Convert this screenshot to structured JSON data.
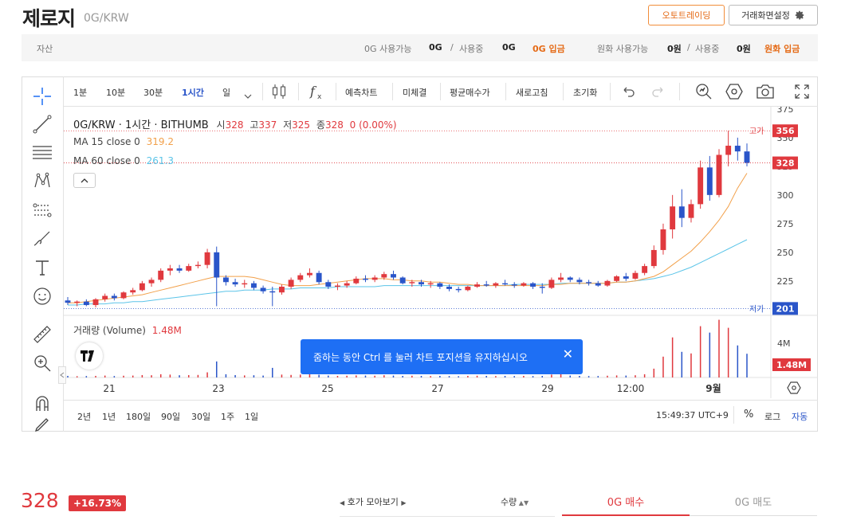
{
  "header": {
    "title": "제로지",
    "pair": "0G/KRW",
    "auto_trading": "오토트레이딩",
    "screen_settings": "거래화면설정"
  },
  "asset_bar": {
    "label": "자산",
    "coin_available_label": "0G 사용가능",
    "coin_available": "0G",
    "coin_in_use_label": "사용중",
    "coin_in_use": "0G",
    "coin_deposit": "0G 입금",
    "krw_available_label": "원화 사용가능",
    "krw_available": "0원",
    "krw_in_use_label": "사용중",
    "krw_in_use": "0원",
    "krw_deposit": "원화 입금"
  },
  "toolbar": {
    "intervals": [
      "1분",
      "10분",
      "30분",
      "1시간",
      "일"
    ],
    "active_interval": "1시간",
    "buttons": [
      "예측차트",
      "미체결",
      "평균매수가",
      "새로고침",
      "초기화"
    ]
  },
  "chart_data": {
    "type": "candlestick",
    "title": "0G/KRW · 1시간 · BITHUMB",
    "ohlc_labels": {
      "open": "시",
      "high": "고",
      "low": "저",
      "volume": "종"
    },
    "ohlc": {
      "open": "328",
      "high": "337",
      "low": "325",
      "close": "328",
      "change": "0 (0.00%)"
    },
    "ma15": {
      "label": "MA 15 close 0",
      "value": "319.2",
      "color": "#f2a04a"
    },
    "ma60": {
      "label": "MA 60 close 0",
      "value": "261.3",
      "color": "#5bc4e8"
    },
    "volume_label": "거래량 (Volume)",
    "volume_value": "1.48M",
    "volume_axis": "4M",
    "price_ticks": [
      375,
      350,
      325,
      300,
      275,
      250,
      225
    ],
    "ylim": [
      195,
      377
    ],
    "high_label": "고가",
    "high_value": 356,
    "low_label": "저가",
    "low_value": 201,
    "last_price": 328,
    "x_ticks": [
      "21",
      "23",
      "25",
      "27",
      "29",
      "12:00",
      "9월"
    ],
    "up_color": "#e0393e",
    "down_color": "#2a55c9",
    "series": [
      {
        "t": 0,
        "o": 208,
        "h": 211,
        "l": 204,
        "c": 206
      },
      {
        "t": 1,
        "o": 206,
        "h": 208,
        "l": 203,
        "c": 207
      },
      {
        "t": 2,
        "o": 207,
        "h": 209,
        "l": 203,
        "c": 204
      },
      {
        "t": 3,
        "o": 204,
        "h": 210,
        "l": 202,
        "c": 209
      },
      {
        "t": 4,
        "o": 209,
        "h": 214,
        "l": 207,
        "c": 212
      },
      {
        "t": 5,
        "o": 212,
        "h": 214,
        "l": 208,
        "c": 210
      },
      {
        "t": 6,
        "o": 210,
        "h": 216,
        "l": 209,
        "c": 215
      },
      {
        "t": 7,
        "o": 215,
        "h": 219,
        "l": 213,
        "c": 217
      },
      {
        "t": 8,
        "o": 217,
        "h": 225,
        "l": 216,
        "c": 223
      },
      {
        "t": 9,
        "o": 223,
        "h": 228,
        "l": 220,
        "c": 226
      },
      {
        "t": 10,
        "o": 226,
        "h": 236,
        "l": 224,
        "c": 234
      },
      {
        "t": 11,
        "o": 234,
        "h": 239,
        "l": 230,
        "c": 236
      },
      {
        "t": 12,
        "o": 236,
        "h": 239,
        "l": 232,
        "c": 234
      },
      {
        "t": 13,
        "o": 234,
        "h": 240,
        "l": 233,
        "c": 238
      },
      {
        "t": 14,
        "o": 238,
        "h": 242,
        "l": 236,
        "c": 239
      },
      {
        "t": 15,
        "o": 239,
        "h": 253,
        "l": 236,
        "c": 250
      },
      {
        "t": 16,
        "o": 250,
        "h": 255,
        "l": 203,
        "c": 228
      },
      {
        "t": 17,
        "o": 228,
        "h": 230,
        "l": 221,
        "c": 224
      },
      {
        "t": 18,
        "o": 224,
        "h": 227,
        "l": 220,
        "c": 222
      },
      {
        "t": 19,
        "o": 222,
        "h": 226,
        "l": 219,
        "c": 223
      },
      {
        "t": 20,
        "o": 223,
        "h": 225,
        "l": 217,
        "c": 219
      },
      {
        "t": 21,
        "o": 219,
        "h": 221,
        "l": 214,
        "c": 216
      },
      {
        "t": 22,
        "o": 216,
        "h": 220,
        "l": 203,
        "c": 215
      },
      {
        "t": 23,
        "o": 215,
        "h": 222,
        "l": 213,
        "c": 220
      },
      {
        "t": 24,
        "o": 220,
        "h": 228,
        "l": 218,
        "c": 226
      },
      {
        "t": 25,
        "o": 226,
        "h": 232,
        "l": 224,
        "c": 230
      },
      {
        "t": 26,
        "o": 230,
        "h": 236,
        "l": 228,
        "c": 232
      },
      {
        "t": 27,
        "o": 232,
        "h": 234,
        "l": 222,
        "c": 224
      },
      {
        "t": 28,
        "o": 224,
        "h": 226,
        "l": 218,
        "c": 220
      },
      {
        "t": 29,
        "o": 220,
        "h": 223,
        "l": 217,
        "c": 221
      },
      {
        "t": 30,
        "o": 221,
        "h": 225,
        "l": 219,
        "c": 223
      },
      {
        "t": 31,
        "o": 223,
        "h": 229,
        "l": 222,
        "c": 227
      },
      {
        "t": 32,
        "o": 227,
        "h": 230,
        "l": 224,
        "c": 226
      },
      {
        "t": 33,
        "o": 226,
        "h": 230,
        "l": 224,
        "c": 228
      },
      {
        "t": 34,
        "o": 228,
        "h": 233,
        "l": 226,
        "c": 231
      },
      {
        "t": 35,
        "o": 231,
        "h": 234,
        "l": 226,
        "c": 228
      },
      {
        "t": 36,
        "o": 228,
        "h": 229,
        "l": 222,
        "c": 223
      },
      {
        "t": 37,
        "o": 223,
        "h": 226,
        "l": 220,
        "c": 224
      },
      {
        "t": 38,
        "o": 224,
        "h": 226,
        "l": 220,
        "c": 222
      },
      {
        "t": 39,
        "o": 222,
        "h": 225,
        "l": 219,
        "c": 223
      },
      {
        "t": 40,
        "o": 223,
        "h": 224,
        "l": 218,
        "c": 220
      },
      {
        "t": 41,
        "o": 220,
        "h": 222,
        "l": 216,
        "c": 218
      },
      {
        "t": 42,
        "o": 218,
        "h": 220,
        "l": 215,
        "c": 217
      },
      {
        "t": 43,
        "o": 217,
        "h": 221,
        "l": 216,
        "c": 220
      },
      {
        "t": 44,
        "o": 220,
        "h": 224,
        "l": 219,
        "c": 222
      },
      {
        "t": 45,
        "o": 222,
        "h": 225,
        "l": 220,
        "c": 221
      },
      {
        "t": 46,
        "o": 221,
        "h": 224,
        "l": 219,
        "c": 223
      },
      {
        "t": 47,
        "o": 223,
        "h": 226,
        "l": 221,
        "c": 222
      },
      {
        "t": 48,
        "o": 222,
        "h": 224,
        "l": 219,
        "c": 221
      },
      {
        "t": 49,
        "o": 221,
        "h": 224,
        "l": 220,
        "c": 223
      },
      {
        "t": 50,
        "o": 223,
        "h": 224,
        "l": 218,
        "c": 220
      },
      {
        "t": 51,
        "o": 220,
        "h": 223,
        "l": 214,
        "c": 219
      },
      {
        "t": 52,
        "o": 219,
        "h": 228,
        "l": 218,
        "c": 226
      },
      {
        "t": 53,
        "o": 226,
        "h": 232,
        "l": 224,
        "c": 228
      },
      {
        "t": 54,
        "o": 228,
        "h": 229,
        "l": 224,
        "c": 226
      },
      {
        "t": 55,
        "o": 226,
        "h": 228,
        "l": 222,
        "c": 224
      },
      {
        "t": 56,
        "o": 224,
        "h": 226,
        "l": 221,
        "c": 223
      },
      {
        "t": 57,
        "o": 223,
        "h": 225,
        "l": 220,
        "c": 221
      },
      {
        "t": 58,
        "o": 221,
        "h": 226,
        "l": 220,
        "c": 225
      },
      {
        "t": 59,
        "o": 225,
        "h": 230,
        "l": 224,
        "c": 229
      },
      {
        "t": 60,
        "o": 229,
        "h": 232,
        "l": 225,
        "c": 227
      },
      {
        "t": 61,
        "o": 227,
        "h": 234,
        "l": 226,
        "c": 232
      },
      {
        "t": 62,
        "o": 232,
        "h": 240,
        "l": 230,
        "c": 238
      },
      {
        "t": 63,
        "o": 238,
        "h": 256,
        "l": 236,
        "c": 252
      },
      {
        "t": 64,
        "o": 252,
        "h": 275,
        "l": 248,
        "c": 270
      },
      {
        "t": 65,
        "o": 270,
        "h": 300,
        "l": 262,
        "c": 290
      },
      {
        "t": 66,
        "o": 290,
        "h": 305,
        "l": 272,
        "c": 280
      },
      {
        "t": 67,
        "o": 280,
        "h": 296,
        "l": 276,
        "c": 292
      },
      {
        "t": 68,
        "o": 292,
        "h": 330,
        "l": 288,
        "c": 324
      },
      {
        "t": 69,
        "o": 324,
        "h": 334,
        "l": 295,
        "c": 300
      },
      {
        "t": 70,
        "o": 300,
        "h": 340,
        "l": 298,
        "c": 335
      },
      {
        "t": 71,
        "o": 335,
        "h": 356,
        "l": 325,
        "c": 343
      },
      {
        "t": 72,
        "o": 343,
        "h": 350,
        "l": 330,
        "c": 338
      },
      {
        "t": 73,
        "o": 338,
        "h": 345,
        "l": 325,
        "c": 328
      }
    ],
    "volume_series": [
      0.1,
      0.08,
      0.09,
      0.1,
      0.12,
      0.09,
      0.11,
      0.12,
      0.15,
      0.14,
      0.2,
      0.18,
      0.14,
      0.15,
      0.16,
      0.32,
      1.0,
      0.2,
      0.15,
      0.13,
      0.14,
      0.12,
      0.6,
      0.18,
      0.16,
      0.18,
      0.22,
      0.17,
      0.12,
      0.1,
      0.11,
      0.13,
      0.12,
      0.11,
      0.14,
      0.12,
      0.1,
      0.11,
      0.1,
      0.09,
      0.1,
      0.09,
      0.08,
      0.1,
      0.11,
      0.1,
      0.09,
      0.1,
      0.09,
      0.1,
      0.09,
      0.1,
      0.18,
      0.2,
      0.12,
      0.1,
      0.09,
      0.09,
      0.11,
      0.13,
      0.12,
      0.14,
      0.2,
      0.55,
      1.3,
      2.5,
      1.6,
      1.5,
      3.2,
      2.8,
      3.6,
      3.1,
      2.0,
      1.48
    ],
    "ma15_values": [
      206,
      206,
      207,
      208,
      209,
      210,
      211,
      212,
      213,
      215,
      217,
      219,
      221,
      223,
      225,
      227,
      229,
      229,
      229,
      229,
      228,
      226,
      224,
      222,
      221,
      221,
      221,
      222,
      223,
      224,
      225,
      226,
      227,
      227,
      227,
      226,
      226,
      225,
      225,
      224,
      224,
      223,
      222,
      222,
      221,
      221,
      221,
      221,
      221,
      221,
      221,
      221,
      222,
      222,
      223,
      223,
      223,
      223,
      223,
      224,
      224,
      225,
      227,
      229,
      233,
      239,
      245,
      251,
      259,
      268,
      278,
      290,
      306,
      319
    ],
    "ma60_values": [
      204,
      204,
      205,
      205,
      205,
      206,
      206,
      207,
      207,
      208,
      209,
      210,
      211,
      212,
      213,
      214,
      215,
      216,
      216,
      217,
      217,
      217,
      218,
      218,
      218,
      219,
      219,
      219,
      219,
      220,
      220,
      220,
      220,
      220,
      221,
      221,
      221,
      221,
      221,
      221,
      221,
      221,
      221,
      221,
      221,
      221,
      221,
      221,
      222,
      222,
      222,
      222,
      222,
      223,
      223,
      223,
      223,
      223,
      223,
      224,
      224,
      225,
      226,
      227,
      229,
      231,
      234,
      237,
      241,
      245,
      249,
      253,
      257,
      261
    ]
  },
  "timebar": {
    "ranges": [
      "2년",
      "1년",
      "180일",
      "90일",
      "30일",
      "1주",
      "1일"
    ],
    "clock": "15:49:37 UTC+9",
    "percent": "%",
    "log": "로그",
    "auto": "자동"
  },
  "toast": {
    "message": "줌하는 동안 Ctrl 를 눌러 차트 포지션을 유지하십시오"
  },
  "bottom": {
    "price": "328",
    "change": "+16.73%",
    "hoga_view": "호가 모아보기",
    "quantity": "수량",
    "buy_tab": "0G 매수",
    "sell_tab": "0G 매도"
  }
}
